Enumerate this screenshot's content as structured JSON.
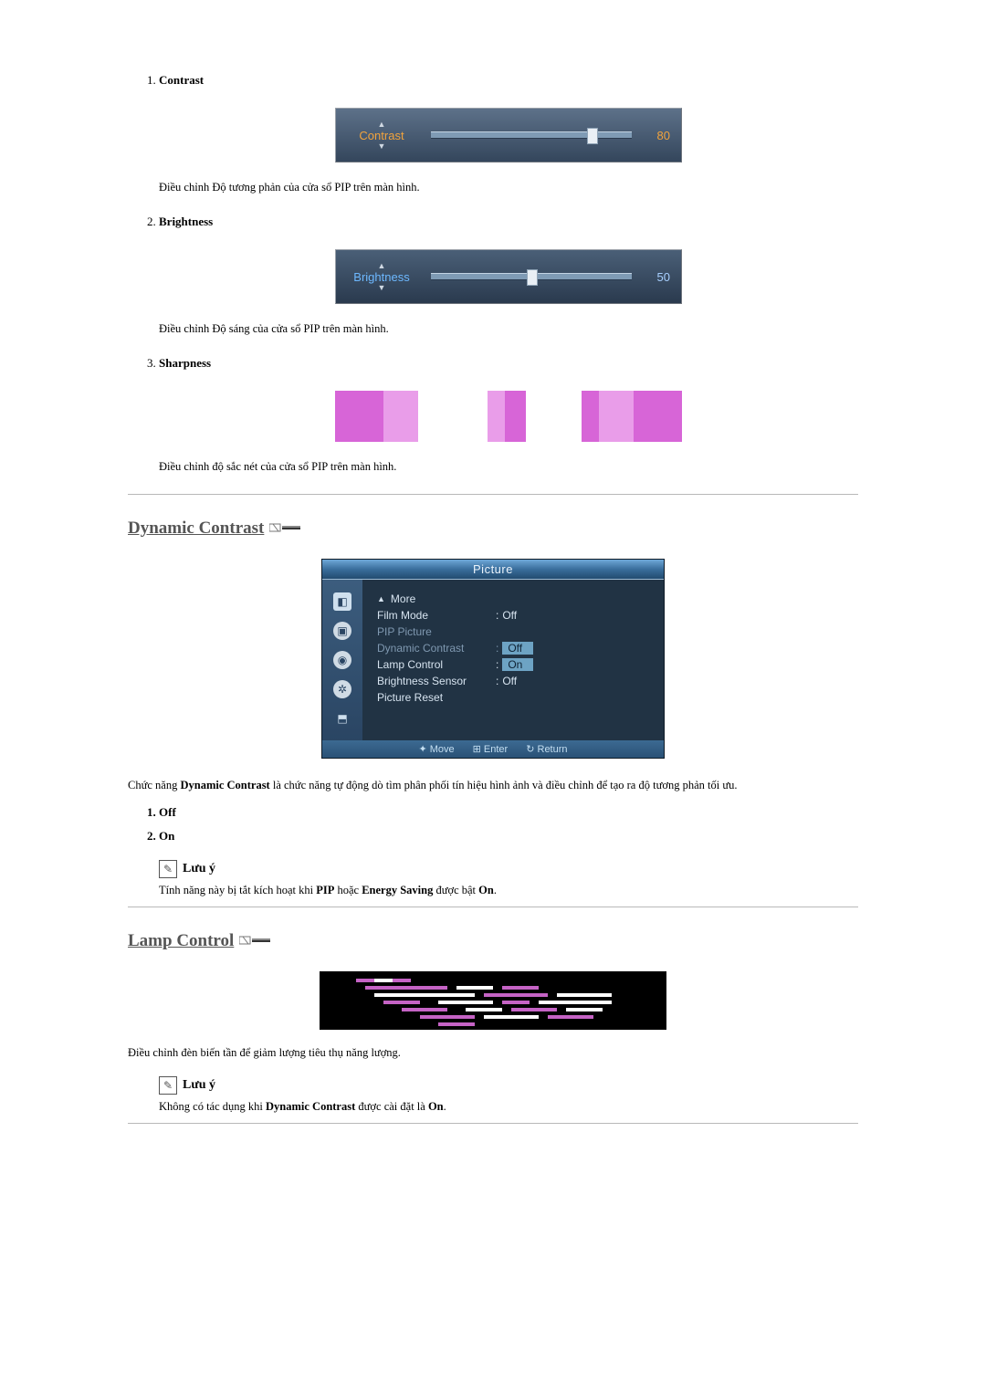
{
  "items": {
    "1": {
      "title": "Contrast",
      "desc": "Điều chỉnh Độ tương phản của cửa sổ PIP trên màn hình."
    },
    "2": {
      "title": "Brightness",
      "desc": "Điều chỉnh Độ sáng của cửa sổ PIP trên màn hình."
    },
    "3": {
      "title": "Sharpness",
      "desc": "Điều chỉnh độ sắc nét của cửa sổ PIP trên màn hình."
    }
  },
  "contrast_slider": {
    "label": "Contrast",
    "value": "80",
    "pos_pct": 80
  },
  "brightness_slider": {
    "label": "Brightness",
    "value": "50",
    "pos_pct": 50
  },
  "dynamic_contrast": {
    "heading": "Dynamic Contrast",
    "osd_title": "Picture",
    "menu": {
      "more": "More",
      "film_mode": {
        "label": "Film Mode",
        "value": "Off"
      },
      "pip_picture": "PIP Picture",
      "dyn_contrast": {
        "label": "Dynamic Contrast",
        "off": "Off",
        "on": "On"
      },
      "lamp_control": "Lamp Control",
      "bright_sensor": {
        "label": "Brightness Sensor",
        "value": "Off"
      },
      "picture_reset": "Picture Reset"
    },
    "footer": {
      "move": "Move",
      "enter": "Enter",
      "return": "Return"
    },
    "body": "Chức năng Dynamic Contrast là chức năng tự động dò tìm phân phối tín hiệu hình ảnh và điều chỉnh để tạo ra độ tương phản tối ưu.",
    "body_bold": "Dynamic Contrast",
    "options": {
      "1": "Off",
      "2": "On"
    },
    "note_label": "Lưu ý",
    "note_body_a": "Tính năng này bị tắt kích hoạt khi ",
    "note_body_pip": "PIP",
    "note_body_b": " hoặc ",
    "note_body_es": "Energy Saving",
    "note_body_c": " được bật ",
    "note_body_on": "On",
    "note_body_d": "."
  },
  "lamp_control": {
    "heading": "Lamp Control",
    "desc": "Điều chỉnh đèn biến tần để giảm lượng tiêu thụ năng lượng.",
    "note_label": "Lưu ý",
    "note_a": "Không có tác dụng khi ",
    "note_dc": "Dynamic Contrast",
    "note_b": " được cài đặt là ",
    "note_on": "On",
    "note_c": "."
  }
}
